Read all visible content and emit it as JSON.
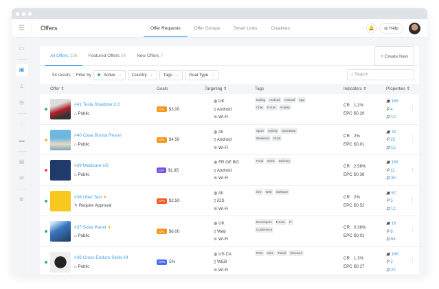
{
  "header": {
    "title": "Offers",
    "nav": [
      "Offer Requests",
      "Offer Groups",
      "Smart Links",
      "Creatives"
    ],
    "help": "Help"
  },
  "tabs": [
    {
      "label": "All Offers",
      "count": "136"
    },
    {
      "label": "Featured Offers",
      "count": "24"
    },
    {
      "label": "New Offers",
      "count": "7"
    }
  ],
  "create_label": "+ Create New",
  "filters": {
    "results": "94 results",
    "filter_by": "Filter by",
    "status": "Active",
    "country": "Country",
    "tags": "Tags",
    "goal_type": "Goal Type",
    "search_placeholder": "Search"
  },
  "columns": [
    "Offer",
    "Goals",
    "Targeting",
    "Tags",
    "Indicators",
    "Properties"
  ],
  "colors": {
    "accent": "#3ea0e8",
    "CPL": "#f7941d",
    "CPI": "#7b4fe0",
    "CPA": "#f05a28",
    "CPS": "#4a6cf0"
  },
  "rows": [
    {
      "status": "#3cb371",
      "title": "#41 Tesla Roadster 2.0",
      "access": "Public",
      "goal_type": "CPL",
      "goal": "$3.00",
      "geo": "UK",
      "device": "Android",
      "conn": "Wi-Fi",
      "tags": [
        "Dating",
        "Android",
        "Android",
        "App",
        "Chat",
        "Forum",
        "Activity"
      ],
      "cr": "1,2%",
      "epc": "$0.20",
      "p1": "168",
      "p2": "4",
      "p3": "10",
      "thumb": "linear-gradient(160deg,#ddd 30%,#b0202a 55%,#333 80%)"
    },
    {
      "status": "#f7b538",
      "title": "#40 Casa Bonita Resort",
      "access": "Public",
      "goal_type": "CPL",
      "goal": "$4.50",
      "geo": "All",
      "device": "Android",
      "conn": "Wi-Fi",
      "tags": [
        "Sport",
        "Activity",
        "Sportwear",
        "Weekend",
        "Drink"
      ],
      "cr": "2%",
      "epc": "$0.01",
      "p1": "32",
      "p2": "25",
      "p3": "15",
      "thumb": "linear-gradient(180deg,#6fb7e3 40%,#e6d9c2 70%,#7aa7c7)"
    },
    {
      "status": "#f0484e",
      "title": "#39 Medicare US",
      "access": "Public",
      "goal_type": "CPI",
      "goal": "$1.85",
      "geo": "FR GE BG",
      "device": "Android",
      "conn": "Wi-Fi",
      "tags": [
        "Food",
        "Drink",
        "Delivery"
      ],
      "cr": "2.56%",
      "epc": "$0.36",
      "p1": "168",
      "p2": "11",
      "p3": "35",
      "thumb": "#1f3a6b"
    },
    {
      "status": "#3cb371",
      "title": "#38 Uber Taxi",
      "star": true,
      "access": "Require Approval",
      "goal_type": "CPA",
      "goal": "$2.50",
      "geo": "All",
      "device": "iOS",
      "conn": "Wi-Fi",
      "tags": [
        "iOS",
        "Web",
        "Software"
      ],
      "cr": "2%",
      "epc": "$0.52",
      "p1": "67",
      "p2": "5",
      "p3": "12",
      "thumb": "#f7c81e"
    },
    {
      "status": "#3cb371",
      "title": "#37 Solar Panel",
      "star": true,
      "access": "Public",
      "goal_type": "CPL",
      "goal": "$6.00",
      "geo": "UK",
      "device": "Web",
      "conn": "Wi-Fi",
      "tags": [
        "Developers",
        "Forum",
        "IT",
        "Conference"
      ],
      "cr": "0.36%",
      "epc": "$0.01",
      "p1": "19",
      "p2": "8",
      "p3": "64",
      "thumb": "linear-gradient(150deg,#cfe6fb 10%,#3a78c0 40%,#223a5c)"
    },
    {
      "status": "#3cb371",
      "title": "#36 Cross Enduro Skills #9",
      "access": "Public",
      "goal_type": "CPS",
      "goal": "5%",
      "geo": "US CA",
      "device": "WEB",
      "conn": "Wi-Fi",
      "tags": [
        "Rent",
        "Cars",
        "Travel",
        "Discount"
      ],
      "cr": "1.3%",
      "epc": "$0.27",
      "p1": "168",
      "p2": "2",
      "p3": "20",
      "thumb": "radial-gradient(circle,#222 40%,#eee 42%)"
    }
  ]
}
